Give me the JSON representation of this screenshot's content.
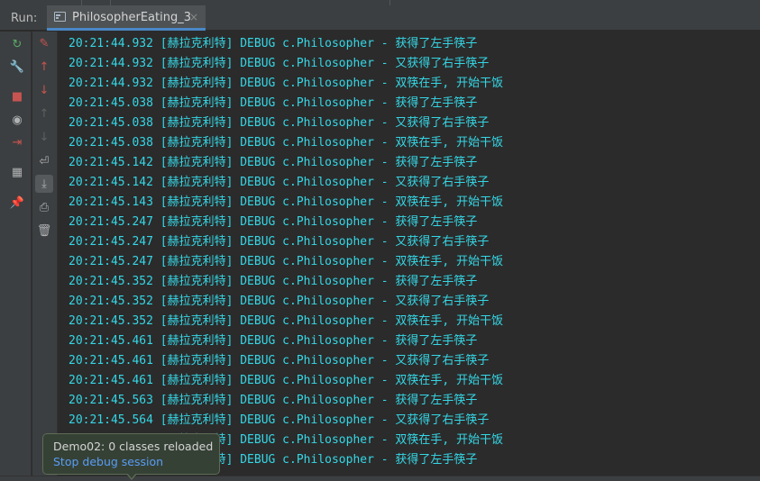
{
  "run_panel": {
    "label": "Run:",
    "tab": {
      "title": "PhilosopherEating_3",
      "close": "×"
    }
  },
  "left_toolbar": [
    {
      "name": "rerun-icon",
      "glyph": "↻",
      "color": "#59a869"
    },
    {
      "name": "wrench-icon",
      "glyph": "🔧",
      "color": "#afb1b3"
    },
    {
      "name": "stop-icon",
      "glyph": "■",
      "color": "#c75450"
    },
    {
      "name": "camera-icon",
      "glyph": "◉",
      "color": "#afb1b3"
    },
    {
      "name": "login-icon",
      "glyph": "⇥",
      "color": "#c75450"
    },
    {
      "name": "layout-icon",
      "glyph": "▦",
      "color": "#afb1b3"
    },
    {
      "name": "pin-icon",
      "glyph": "📌",
      "color": "#afb1b3"
    }
  ],
  "right_toolbar": [
    {
      "name": "clear-icon",
      "glyph": "✎",
      "color": "#c75450"
    },
    {
      "name": "up-arrow-icon",
      "glyph": "↑",
      "color": "#c75450"
    },
    {
      "name": "down-arrow-icon",
      "glyph": "↓",
      "color": "#c75450"
    },
    {
      "name": "up-arrow-disabled-icon",
      "glyph": "↑",
      "color": "#5e6060"
    },
    {
      "name": "down-arrow-disabled-icon",
      "glyph": "↓",
      "color": "#5e6060"
    },
    {
      "name": "soft-wrap-icon",
      "glyph": "⏎",
      "color": "#afb1b3"
    },
    {
      "name": "scroll-to-end-icon",
      "glyph": "⤓",
      "color": "#afb1b3"
    },
    {
      "name": "print-icon",
      "glyph": "⎙",
      "color": "#afb1b3"
    },
    {
      "name": "trash-icon",
      "glyph": "🗑",
      "color": "#afb1b3"
    }
  ],
  "console_lines": [
    "20:21:44.932 [赫拉克利特] DEBUG c.Philosopher - 获得了左手筷子",
    "20:21:44.932 [赫拉克利特] DEBUG c.Philosopher - 又获得了右手筷子",
    "20:21:44.932 [赫拉克利特] DEBUG c.Philosopher - 双筷在手, 开始干饭",
    "20:21:45.038 [赫拉克利特] DEBUG c.Philosopher - 获得了左手筷子",
    "20:21:45.038 [赫拉克利特] DEBUG c.Philosopher - 又获得了右手筷子",
    "20:21:45.038 [赫拉克利特] DEBUG c.Philosopher - 双筷在手, 开始干饭",
    "20:21:45.142 [赫拉克利特] DEBUG c.Philosopher - 获得了左手筷子",
    "20:21:45.142 [赫拉克利特] DEBUG c.Philosopher - 又获得了右手筷子",
    "20:21:45.143 [赫拉克利特] DEBUG c.Philosopher - 双筷在手, 开始干饭",
    "20:21:45.247 [赫拉克利特] DEBUG c.Philosopher - 获得了左手筷子",
    "20:21:45.247 [赫拉克利特] DEBUG c.Philosopher - 又获得了右手筷子",
    "20:21:45.247 [赫拉克利特] DEBUG c.Philosopher - 双筷在手, 开始干饭",
    "20:21:45.352 [赫拉克利特] DEBUG c.Philosopher - 获得了左手筷子",
    "20:21:45.352 [赫拉克利特] DEBUG c.Philosopher - 又获得了右手筷子",
    "20:21:45.352 [赫拉克利特] DEBUG c.Philosopher - 双筷在手, 开始干饭",
    "20:21:45.461 [赫拉克利特] DEBUG c.Philosopher - 获得了左手筷子",
    "20:21:45.461 [赫拉克利特] DEBUG c.Philosopher - 又获得了右手筷子",
    "20:21:45.461 [赫拉克利特] DEBUG c.Philosopher - 双筷在手, 开始干饭",
    "20:21:45.563 [赫拉克利特] DEBUG c.Philosopher - 获得了左手筷子",
    "20:21:45.564 [赫拉克利特] DEBUG c.Philosopher - 又获得了右手筷子",
    "20:21:45.564 [赫拉克利特] DEBUG c.Philosopher - 双筷在手, 开始干饭",
    "20:21:45.564 [赫拉克利特] DEBUG c.Philosopher - 获得了左手筷子"
  ],
  "notification": {
    "title": "Demo02: 0 classes reloaded",
    "action": "Stop debug session"
  },
  "colors": {
    "console_text": "#35d7e6",
    "link": "#589df6",
    "tab_underline": "#4a88c7"
  }
}
